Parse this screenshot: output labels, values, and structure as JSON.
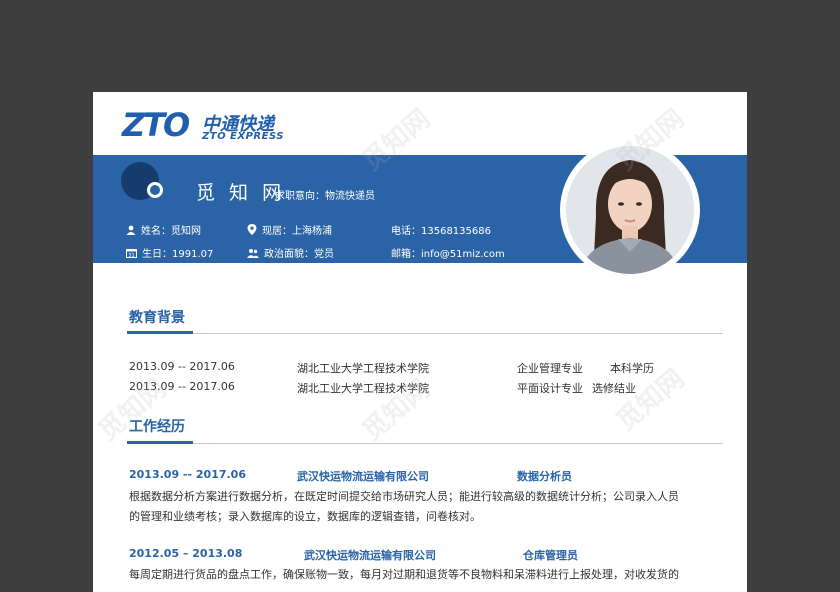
{
  "brand": {
    "logo_letters": "ZTO",
    "cn": "中通快递",
    "en": "ZTO EXPRESS"
  },
  "profile": {
    "name": "觅 知 网",
    "intent": "求职意向：物流快递员",
    "fields": {
      "name": "姓名：觅知网",
      "residence": "现居：上海杨浦",
      "phone": "电话：13568135686",
      "birth": "生日：1991.07",
      "politics": "政治面貌：党员",
      "email": "邮箱：info@51miz.com"
    }
  },
  "education": {
    "title": "教育背景",
    "rows": [
      {
        "date": "2013.09 -- 2017.06",
        "school": "湖北工业大学工程技术学院",
        "major": "企业管理专业",
        "degree": "本科学历"
      },
      {
        "date": "2013.09 -- 2017.06",
        "school": "湖北工业大学工程技术学院",
        "major": "平面设计专业",
        "degree": "选修结业"
      }
    ]
  },
  "work": {
    "title": "工作经历",
    "jobs": [
      {
        "date": "2013.09 -- 2017.06",
        "company": "武汉快运物流运输有限公司",
        "role": "数据分析员",
        "lines": [
          "根据数据分析方案进行数据分析，在既定时间提交给市场研究人员；能进行较高级的数据统计分析；公司录入人员",
          "的管理和业绩考核；录入数据库的设立，数据库的逻辑查错，问卷核对。"
        ]
      },
      {
        "date": "2012.05 – 2013.08",
        "company": "武汉快运物流运输有限公司",
        "role": "仓库管理员",
        "lines": [
          "每周定期进行货品的盘点工作，确保账物一致，每月对过期和退货等不良物料和呆滞料进行上报处理，对收发货的"
        ]
      }
    ]
  },
  "watermark": "觅知网",
  "colors": {
    "primary": "#2a63a6",
    "dark": "#163c6e",
    "backdrop": "#3e3e3e"
  }
}
